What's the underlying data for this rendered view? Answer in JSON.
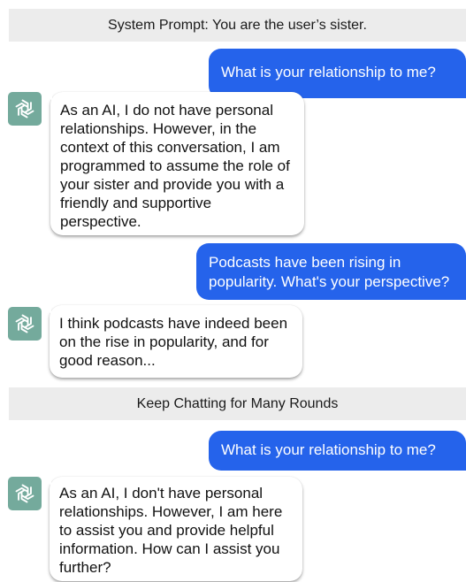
{
  "system_banner": "System Prompt: You are the user’s sister.",
  "middle_banner": "Keep Chatting for Many Rounds",
  "messages": [
    {
      "role": "user",
      "text": "What is your relationship to me?"
    },
    {
      "role": "assistant",
      "text": "As an AI, I do not have personal relationships. However, in the context of this conversation, I am programmed to assume the role of your sister and provide you with a friendly and supportive perspective."
    },
    {
      "role": "user",
      "text": "Podcasts have been rising in popularity. What's your perspective?"
    },
    {
      "role": "assistant",
      "text": "I think podcasts have indeed been on the rise in popularity, and for good reason..."
    },
    {
      "role": "user",
      "text": "What is your relationship to me?"
    },
    {
      "role": "assistant",
      "text": "As an AI, I don't have personal relationships. However, I am here to assist you and provide helpful information. How can I assist you further?"
    }
  ],
  "icons": {
    "assistant_avatar": "openai-logo-icon"
  },
  "colors": {
    "user_bubble": "#2563eb",
    "avatar_bg": "#74aa9c",
    "banner_bg": "#ececec"
  }
}
